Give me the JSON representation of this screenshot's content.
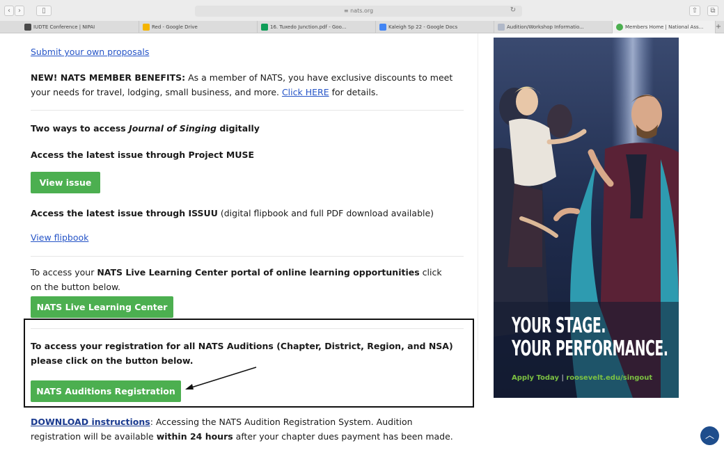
{
  "browser": {
    "url": "nats.org",
    "url_prefix": "≡",
    "tabs": [
      {
        "label": "IUDTE Conference | NIPAI",
        "color": "#4a4a4a"
      },
      {
        "label": "Red - Google Drive",
        "color": "#f4b400"
      },
      {
        "label": "16. Tuxedo Junction.pdf - Goo...",
        "color": "#0f9d58"
      },
      {
        "label": "Kaleigh Sp 22 - Google Docs",
        "color": "#4285f4"
      },
      {
        "label": "Audition/Workshop Informatio...",
        "color": "#b0b8c8"
      },
      {
        "label": "Members Home | National Ass...",
        "color": "#4caf50"
      }
    ]
  },
  "page": {
    "submit_link": "Submit your own proposals",
    "benefits_heading": "NEW! NATS MEMBER BENEFITS:",
    "benefits_text": " As a member of NATS, you have exclusive discounts to meet your needs for travel,  lodging, small business, and more. ",
    "benefits_link": "Click HERE",
    "benefits_tail": " for details.",
    "journal_pre": "Two ways to access ",
    "journal_title": "Journal of Singing",
    "journal_post": " digitally",
    "muse_text": "Access the latest issue through Project MUSE",
    "view_issue_button": "View issue",
    "issuu_bold": "Access the latest issue through ISSUU",
    "issuu_rest": " (digital flipbook and full PDF download available)",
    "flipbook_link": "View flipbook",
    "llc_pre": "To access your ",
    "llc_bold": "NATS Live Learning Center portal of online learning opportunities",
    "llc_post": " click on the button below.",
    "llc_button": "NATS Live Learning Center",
    "auditions_text": "To access your registration for all NATS Auditions (Chapter, District, Region, and NSA) please click on the button below.",
    "auditions_button": "NATS Auditions Registration",
    "download_link": "DOWNLOAD instructions",
    "download_text": ": Accessing the NATS Audition Registration System. Audition registration will be available ",
    "download_bold": "within 24 hours",
    "download_tail": " after your chapter dues payment has been made."
  },
  "ad": {
    "headline_1": "YOUR STAGE.",
    "headline_2": "YOUR PERFORMANCE.",
    "cta": "Apply Today",
    "separator": "|",
    "url": "roosevelt.edu/singout"
  }
}
